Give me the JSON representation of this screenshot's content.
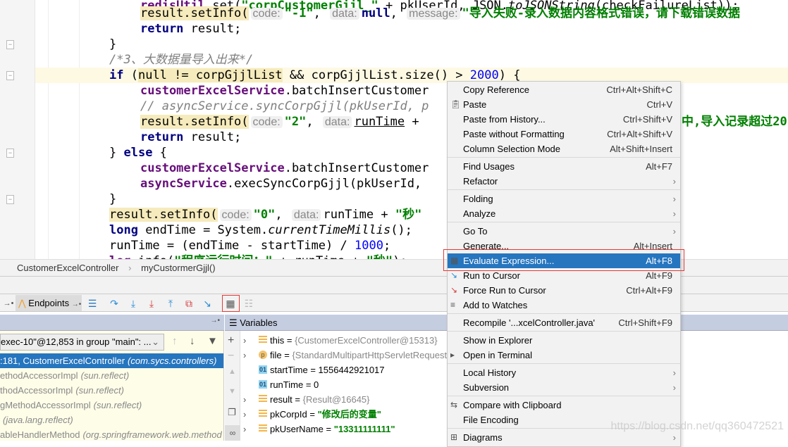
{
  "editor": {
    "lines": [
      [
        {
          "t": "redisUtil",
          "k": "fld"
        },
        {
          "t": ".set("
        },
        {
          "t": "\"corpCustomerGjjl_\"",
          "k": "str"
        },
        {
          "t": " + pkUserId, JSON."
        },
        {
          "t": "toJSONString",
          "k": "itl"
        },
        {
          "t": "(checkFailureList));"
        }
      ],
      [
        {
          "t": "result.setInfo(",
          "k": "hl"
        },
        {
          "t": "code:",
          "k": "hint"
        },
        {
          "t": "\"-1\"",
          "k": "str"
        },
        {
          "t": ", "
        },
        {
          "t": "data:",
          "k": "hint"
        },
        {
          "t": "null",
          "k": "kw"
        },
        {
          "t": ", "
        },
        {
          "t": "message:",
          "k": "hint"
        },
        {
          "t": "\"导入失败-录入数据内容格式错误，请下载错误数据",
          "k": "str"
        }
      ],
      [
        {
          "t": "return",
          "k": "kw"
        },
        {
          "t": " result;"
        }
      ],
      [
        {
          "t": "}"
        }
      ],
      [
        {
          "t": "/*3、大数据量导入出来*/",
          "k": "cmt"
        }
      ],
      [
        {
          "t": "if",
          "k": "kw"
        },
        {
          "t": " ("
        },
        {
          "t": "null != corpGjjlList",
          "k": "hl"
        },
        {
          "t": " && corpGjjlList.size() > "
        },
        {
          "t": "2000",
          "k": "num"
        },
        {
          "t": ") {"
        }
      ],
      [
        {
          "t": "customerExcelService",
          "k": "fld"
        },
        {
          "t": ".batchInsertCustomer"
        }
      ],
      [
        {
          "t": "// asyncService.syncCorpGjjl(pkUserId, p",
          "k": "cmt"
        }
      ],
      [
        {
          "t": "result.setInfo(",
          "k": "hl"
        },
        {
          "t": "code:",
          "k": "hint"
        },
        {
          "t": "\"2\"",
          "k": "str"
        },
        {
          "t": ", "
        },
        {
          "t": "data:",
          "k": "hint"
        },
        {
          "t": "runTime",
          "k": "ul"
        },
        {
          "t": " + "
        }
      ],
      [
        {
          "t": "return",
          "k": "kw"
        },
        {
          "t": " result;"
        }
      ],
      [
        {
          "t": "} "
        },
        {
          "t": "else",
          "k": "kw"
        },
        {
          "t": " {"
        }
      ],
      [
        {
          "t": "customerExcelService",
          "k": "fld"
        },
        {
          "t": ".batchInsertCustomer"
        }
      ],
      [
        {
          "t": "asyncService",
          "k": "fld"
        },
        {
          "t": ".execSyncCorpGjjl(pkUserId,"
        }
      ],
      [
        {
          "t": "}"
        }
      ],
      [
        {
          "t": "result.setInfo(",
          "k": "hl"
        },
        {
          "t": "code:",
          "k": "hint"
        },
        {
          "t": "\"0\"",
          "k": "str"
        },
        {
          "t": ", "
        },
        {
          "t": "data:",
          "k": "hint"
        },
        {
          "t": "runTime + "
        },
        {
          "t": "\"秒\"",
          "k": "str"
        }
      ],
      [
        {
          "t": "long",
          "k": "kw"
        },
        {
          "t": " endTime = System."
        },
        {
          "t": "currentTimeMillis",
          "k": "itl"
        },
        {
          "t": "();"
        }
      ],
      [
        {
          "t": "runTime = (endTime - startTime) / "
        },
        {
          "t": "1000",
          "k": "num"
        },
        {
          "t": ";"
        }
      ],
      [
        {
          "t": "log",
          "k": "fld"
        },
        {
          "t": ".info("
        },
        {
          "t": "\"程序运行时间：\"",
          "k": "str"
        },
        {
          "t": " + runTime + "
        },
        {
          "t": "\"秒\"",
          "k": "str"
        },
        {
          "t": ");"
        }
      ]
    ],
    "overflow_fragment": "中,导入记录超过20"
  },
  "breadcrumb": [
    "CustomerExcelController",
    "›",
    "myCustormerGjjl()"
  ],
  "debug_toolbar": {
    "endpoints_label": "Endpoints",
    "pin": "→•"
  },
  "frames": {
    "thread": "exec-10\"@12,853 in group \"main\": ...",
    "items": [
      {
        "name": ":181, CustomerExcelController",
        "pkg": "(com.sycs.controllers)",
        "selected": true
      },
      {
        "name": "ethodAccessorImpl",
        "pkg": "(sun.reflect)"
      },
      {
        "name": "thodAccessorImpl",
        "pkg": "(sun.reflect)"
      },
      {
        "name": "gMethodAccessorImpl",
        "pkg": "(sun.reflect)"
      },
      {
        "name": "",
        "pkg": "(java.lang.reflect)"
      },
      {
        "name": "ableHandlerMethod",
        "pkg": "(org.springframework.web.method"
      }
    ]
  },
  "variables": {
    "title": "Variables",
    "items": [
      {
        "icon": "obj",
        "name": "this",
        "value": "{CustomerExcelController@15313}",
        "kind": "ref",
        "expandable": true
      },
      {
        "icon": "par",
        "name": "file",
        "value": "{StandardMultipartHttpServletRequest",
        "kind": "ref",
        "expandable": true
      },
      {
        "icon": "prim",
        "name": "startTime",
        "value": "1556442921017",
        "kind": "num",
        "expandable": false
      },
      {
        "icon": "prim",
        "name": "runTime",
        "value": "0",
        "kind": "num",
        "expandable": false
      },
      {
        "icon": "obj",
        "name": "result",
        "value": "{Result@16645}",
        "kind": "ref",
        "expandable": true
      },
      {
        "icon": "obj",
        "name": "pkCorpId",
        "value": "\"修改后的变量\"",
        "kind": "str",
        "expandable": true
      },
      {
        "icon": "obj",
        "name": "pkUserName",
        "value": "\"13311111111\"",
        "kind": "str",
        "expandable": true
      }
    ]
  },
  "context_menu": {
    "groups": [
      [
        {
          "label": "Copy Reference",
          "shortcut": "Ctrl+Alt+Shift+C"
        },
        {
          "label": "Paste",
          "shortcut": "Ctrl+V",
          "icon": "clipboard-icon"
        },
        {
          "label": "Paste from History...",
          "shortcut": "Ctrl+Shift+V"
        },
        {
          "label": "Paste without Formatting",
          "shortcut": "Ctrl+Alt+Shift+V"
        },
        {
          "label": "Column Selection Mode",
          "shortcut": "Alt+Shift+Insert"
        }
      ],
      [
        {
          "label": "Find Usages",
          "shortcut": "Alt+F7"
        },
        {
          "label": "Refactor",
          "submenu": true
        }
      ],
      [
        {
          "label": "Folding",
          "submenu": true
        },
        {
          "label": "Analyze",
          "submenu": true
        }
      ],
      [
        {
          "label": "Go To",
          "submenu": true
        },
        {
          "label": "Generate...",
          "shortcut": "Alt+Insert"
        },
        {
          "label": "Evaluate Expression...",
          "shortcut": "Alt+F8",
          "icon": "calculator-icon",
          "active": true
        },
        {
          "label": "Run to Cursor",
          "shortcut": "Alt+F9",
          "icon": "run-to-cursor-icon"
        },
        {
          "label": "Force Run to Cursor",
          "shortcut": "Ctrl+Alt+F9",
          "icon": "force-run-icon"
        },
        {
          "label": "Add to Watches",
          "icon": "watches-icon"
        }
      ],
      [
        {
          "label": "Recompile '...xcelController.java'",
          "shortcut": "Ctrl+Shift+F9"
        }
      ],
      [
        {
          "label": "Show in Explorer"
        },
        {
          "label": "Open in Terminal",
          "icon": "terminal-icon"
        }
      ],
      [
        {
          "label": "Local History",
          "submenu": true
        },
        {
          "label": "Subversion",
          "submenu": true
        }
      ],
      [
        {
          "label": "Compare with Clipboard",
          "icon": "compare-icon"
        },
        {
          "label": "File Encoding"
        }
      ],
      [
        {
          "label": "Diagrams",
          "submenu": true,
          "icon": "diagrams-icon"
        }
      ]
    ]
  },
  "watermark": "https://blog.csdn.net/qq360472521",
  "colors": {
    "selection": "#2675bf",
    "highlight_box": "#e53935",
    "current_line": "#fdf9e3"
  }
}
